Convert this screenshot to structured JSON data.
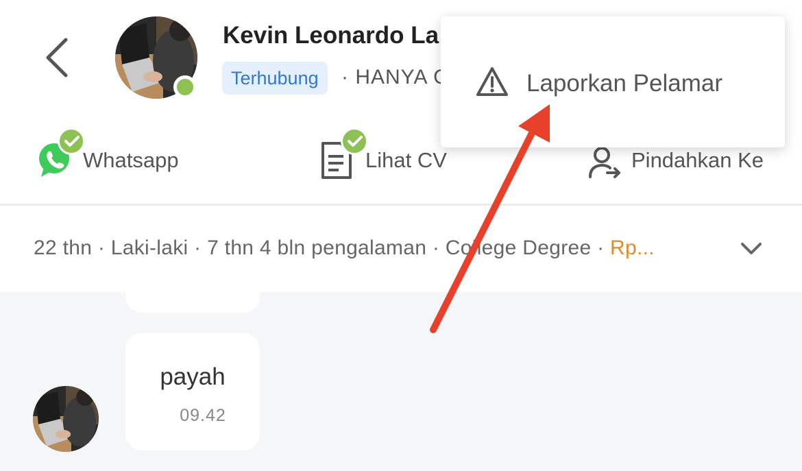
{
  "header": {
    "back_icon": "chevron-left-icon",
    "candidate_name": "Kevin Leonardo La",
    "status_tag": "Terhubung",
    "subtitle": "· HANYA C",
    "online_color": "#8dc154"
  },
  "actions": [
    {
      "label": "Whatsapp",
      "icon": "whatsapp-icon",
      "verified": true
    },
    {
      "label": "Lihat CV",
      "icon": "document-icon",
      "verified": true
    },
    {
      "label": "Pindahkan Ke",
      "icon": "move-user-icon",
      "verified": false
    }
  ],
  "info_bar": {
    "details": "22 thn · Laki-laki · 7 thn 4 bln pengalaman · College Degree · ",
    "salary": "Rp...",
    "salary_color": "#e08b2e",
    "expand_icon": "chevron-down-icon"
  },
  "chat": {
    "messages": [
      {
        "text": "payah",
        "time": "09.42"
      }
    ]
  },
  "popup_menu": {
    "items": [
      {
        "label": "Laporkan Pelamar",
        "icon": "warning-icon"
      }
    ]
  },
  "annotation": {
    "arrow_color": "#e8412b"
  }
}
